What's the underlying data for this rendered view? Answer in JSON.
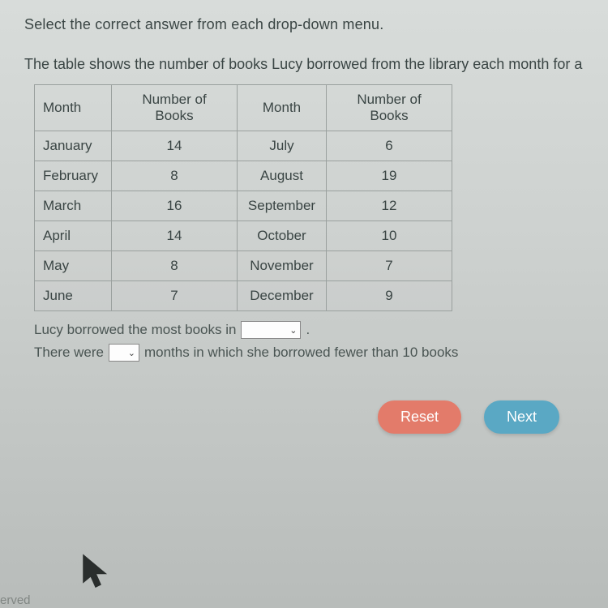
{
  "instruction": "Select the correct answer from each drop-down menu.",
  "context": "The table shows the number of books Lucy borrowed from the library each month for a",
  "table": {
    "headers": {
      "c1": "Month",
      "c2": "Number of Books",
      "c3": "Month",
      "c4": "Number of Books"
    },
    "rows": [
      {
        "m1": "January",
        "b1": "14",
        "m2": "July",
        "b2": "6"
      },
      {
        "m1": "February",
        "b1": "8",
        "m2": "August",
        "b2": "19"
      },
      {
        "m1": "March",
        "b1": "16",
        "m2": "September",
        "b2": "12"
      },
      {
        "m1": "April",
        "b1": "14",
        "m2": "October",
        "b2": "10"
      },
      {
        "m1": "May",
        "b1": "8",
        "m2": "November",
        "b2": "7"
      },
      {
        "m1": "June",
        "b1": "7",
        "m2": "December",
        "b2": "9"
      }
    ]
  },
  "q1_a": "Lucy borrowed the most books in",
  "q1_b": ".",
  "q2_a": "There were",
  "q2_b": "months in which she borrowed fewer than 10 books",
  "buttons": {
    "reset": "Reset",
    "next": "Next"
  },
  "footer": "erved"
}
